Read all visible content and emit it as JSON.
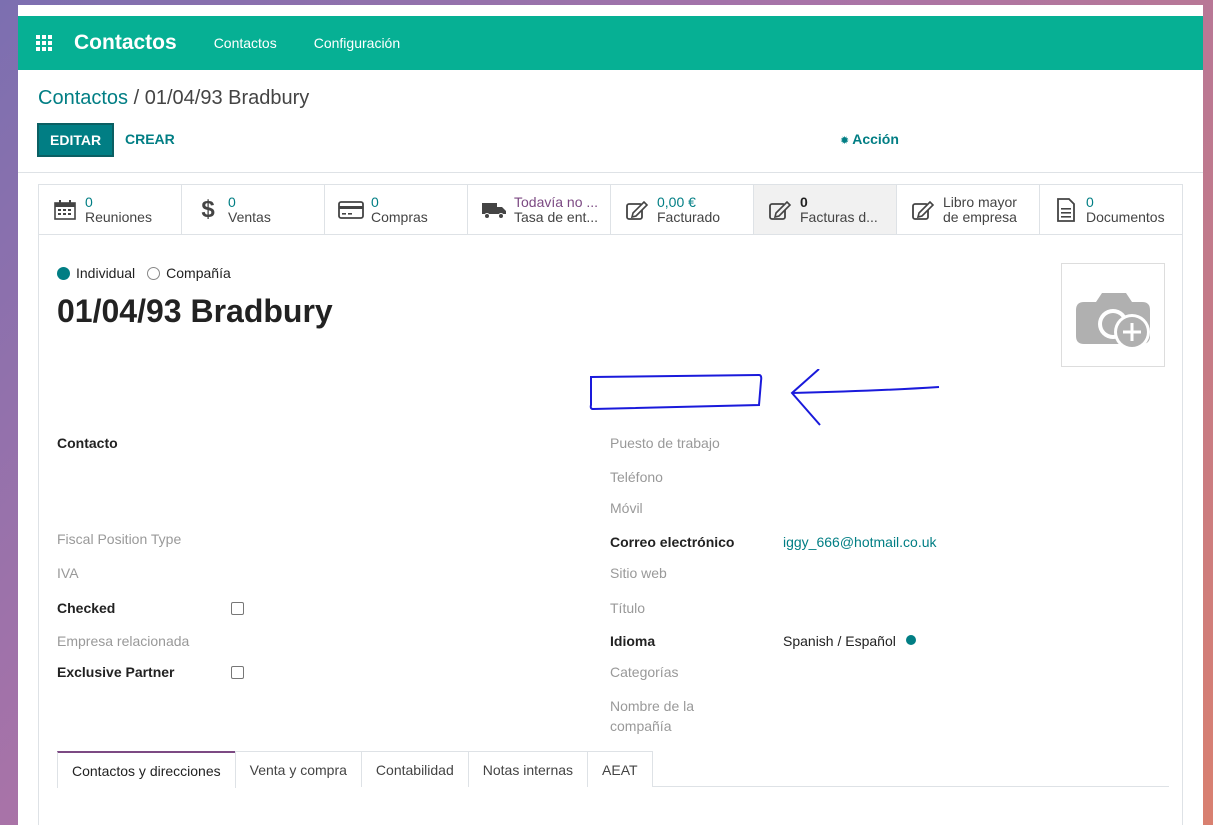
{
  "navbar": {
    "app_title": "Contactos",
    "menu": [
      "Contactos",
      "Configuración"
    ],
    "apps_icon": "apps-grid-icon"
  },
  "control_panel": {
    "breadcrumb_parent": "Contactos",
    "breadcrumb_separator": "/",
    "breadcrumb_current": "01/04/93 Bradbury",
    "edit_label": "EDITAR",
    "create_label": "CREAR",
    "action_label": "Acción",
    "action_icon": "gear-icon"
  },
  "stat_buttons": [
    {
      "icon": "calendar-icon",
      "value": "0",
      "label": "Reuniones"
    },
    {
      "icon": "dollar-icon",
      "value": "0",
      "label": "Ventas"
    },
    {
      "icon": "credit-card-icon",
      "value": "0",
      "label": "Compras"
    },
    {
      "icon": "truck-icon",
      "value": "Todavía no ...",
      "label": "Tasa de ent..."
    },
    {
      "icon": "pencil-square-icon",
      "value": "0,00 €",
      "label": "Facturado"
    },
    {
      "icon": "pencil-square-icon",
      "value": "0",
      "label": "Facturas d..."
    },
    {
      "icon": "pencil-square-icon",
      "value": "Libro mayor",
      "label": "de empresa"
    },
    {
      "icon": "document-icon",
      "value": "0",
      "label": "Documentos"
    }
  ],
  "form": {
    "type_individual": "Individual",
    "type_company": "Compañía",
    "selected_type": "Individual",
    "name": "01/04/93 Bradbury",
    "avatar_icon": "camera-plus-icon",
    "left_fields": {
      "contact": "Contacto",
      "fiscal_position_type": "Fiscal Position Type",
      "vat": "IVA",
      "checked": "Checked",
      "related_company": "Empresa relacionada",
      "exclusive_partner": "Exclusive Partner"
    },
    "right_fields": {
      "job_position": "Puesto de trabajo",
      "phone": "Teléfono",
      "mobile": "Móvil",
      "email_label": "Correo electrónico",
      "email_value": "iggy_666@hotmail.co.uk",
      "website": "Sitio web",
      "title": "Título",
      "language_label": "Idioma",
      "language_value": "Spanish / Español",
      "categories": "Categorías",
      "company_name_line1": "Nombre de la",
      "company_name_line2": "compañía"
    }
  },
  "tabs": [
    "Contactos y direcciones",
    "Venta y compra",
    "Contabilidad",
    "Notas internas",
    "AEAT"
  ],
  "annotation_color": "#1a1adb"
}
